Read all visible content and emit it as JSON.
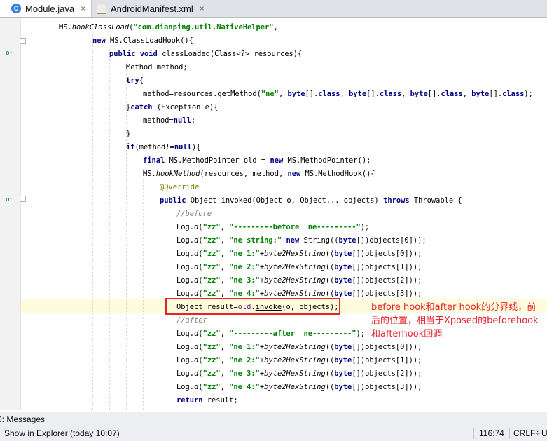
{
  "tabs": [
    {
      "label": "Module.java",
      "icon": "java-class-icon",
      "icon_letter": "C",
      "active": true
    },
    {
      "label": "AndroidManifest.xml",
      "icon": "xml-file-icon",
      "active": false
    }
  ],
  "close_glyph": "×",
  "code": [
    {
      "segs": [
        {
          "t": "MS."
        },
        {
          "t": "hookClassLoad",
          "c": "it"
        },
        {
          "t": "("
        },
        {
          "t": "\"com.dianping.util.NativeHelper\"",
          "c": "str"
        },
        {
          "t": ","
        }
      ]
    },
    {
      "segs": [
        {
          "t": "new ",
          "c": "kw"
        },
        {
          "t": "MS.ClassLoadHook(){"
        }
      ]
    },
    {
      "segs": [
        {
          "t": "public void ",
          "c": "kw"
        },
        {
          "t": "classLoaded(Class<?> resources){"
        }
      ]
    },
    {
      "segs": [
        {
          "t": "Method method;"
        }
      ]
    },
    {
      "segs": [
        {
          "t": "try",
          "c": "kw"
        },
        {
          "t": "{"
        }
      ]
    },
    {
      "segs": [
        {
          "t": "method=resources.getMethod("
        },
        {
          "t": "\"ne\"",
          "c": "str"
        },
        {
          "t": ", "
        },
        {
          "t": "byte",
          "c": "kw"
        },
        {
          "t": "[]."
        },
        {
          "t": "class",
          "c": "kw"
        },
        {
          "t": ", "
        },
        {
          "t": "byte",
          "c": "kw"
        },
        {
          "t": "[]."
        },
        {
          "t": "class",
          "c": "kw"
        },
        {
          "t": ", "
        },
        {
          "t": "byte",
          "c": "kw"
        },
        {
          "t": "[]."
        },
        {
          "t": "class",
          "c": "kw"
        },
        {
          "t": ", "
        },
        {
          "t": "byte",
          "c": "kw"
        },
        {
          "t": "[]."
        },
        {
          "t": "class",
          "c": "kw"
        },
        {
          "t": ");"
        }
      ]
    },
    {
      "segs": [
        {
          "t": "}"
        },
        {
          "t": "catch ",
          "c": "kw"
        },
        {
          "t": "(Exception e){"
        }
      ]
    },
    {
      "segs": [
        {
          "t": "method="
        },
        {
          "t": "null",
          "c": "kw"
        },
        {
          "t": ";"
        }
      ]
    },
    {
      "segs": [
        {
          "t": "}"
        }
      ]
    },
    {
      "segs": [
        {
          "t": "if",
          "c": "kw"
        },
        {
          "t": "(method!="
        },
        {
          "t": "null",
          "c": "kw"
        },
        {
          "t": "){"
        }
      ]
    },
    {
      "segs": [
        {
          "t": "final ",
          "c": "kw"
        },
        {
          "t": "MS.MethodPointer old = "
        },
        {
          "t": "new ",
          "c": "kw"
        },
        {
          "t": "MS.MethodPointer();"
        }
      ]
    },
    {
      "segs": [
        {
          "t": "MS."
        },
        {
          "t": "hookMethod",
          "c": "it"
        },
        {
          "t": "(resources, method, "
        },
        {
          "t": "new ",
          "c": "kw"
        },
        {
          "t": "MS.MethodHook(){"
        }
      ]
    },
    {
      "segs": [
        {
          "t": "@Override",
          "c": "ann"
        }
      ]
    },
    {
      "segs": [
        {
          "t": "public ",
          "c": "kw"
        },
        {
          "t": "Object invoked(Object o, Object... objects) "
        },
        {
          "t": "throws ",
          "c": "kw"
        },
        {
          "t": "Throwable {"
        }
      ]
    },
    {
      "segs": [
        {
          "t": "//before",
          "c": "cm"
        }
      ]
    },
    {
      "segs": [
        {
          "t": "Log."
        },
        {
          "t": "d",
          "c": "it"
        },
        {
          "t": "("
        },
        {
          "t": "\"zz\"",
          "c": "str"
        },
        {
          "t": ", "
        },
        {
          "t": "\"---------before  ne---------\"",
          "c": "str"
        },
        {
          "t": ");"
        }
      ]
    },
    {
      "segs": [
        {
          "t": "Log."
        },
        {
          "t": "d",
          "c": "it"
        },
        {
          "t": "("
        },
        {
          "t": "\"zz\"",
          "c": "str"
        },
        {
          "t": ", "
        },
        {
          "t": "\"ne string:\"",
          "c": "str"
        },
        {
          "t": "+"
        },
        {
          "t": "new ",
          "c": "kw"
        },
        {
          "t": "String(("
        },
        {
          "t": "byte",
          "c": "kw"
        },
        {
          "t": "[])objects[0]));"
        }
      ]
    },
    {
      "segs": [
        {
          "t": "Log."
        },
        {
          "t": "d",
          "c": "it"
        },
        {
          "t": "("
        },
        {
          "t": "\"zz\"",
          "c": "str"
        },
        {
          "t": ", "
        },
        {
          "t": "\"ne 1:\"",
          "c": "str"
        },
        {
          "t": "+"
        },
        {
          "t": "byte2HexString",
          "c": "it"
        },
        {
          "t": "(("
        },
        {
          "t": "byte",
          "c": "kw"
        },
        {
          "t": "[])objects[0]));"
        }
      ]
    },
    {
      "segs": [
        {
          "t": "Log."
        },
        {
          "t": "d",
          "c": "it"
        },
        {
          "t": "("
        },
        {
          "t": "\"zz\"",
          "c": "str"
        },
        {
          "t": ", "
        },
        {
          "t": "\"ne 2:\"",
          "c": "str"
        },
        {
          "t": "+"
        },
        {
          "t": "byte2HexString",
          "c": "it"
        },
        {
          "t": "(("
        },
        {
          "t": "byte",
          "c": "kw"
        },
        {
          "t": "[])objects[1]));"
        }
      ]
    },
    {
      "segs": [
        {
          "t": "Log."
        },
        {
          "t": "d",
          "c": "it"
        },
        {
          "t": "("
        },
        {
          "t": "\"zz\"",
          "c": "str"
        },
        {
          "t": ", "
        },
        {
          "t": "\"ne 3:\"",
          "c": "str"
        },
        {
          "t": "+"
        },
        {
          "t": "byte2HexString",
          "c": "it"
        },
        {
          "t": "(("
        },
        {
          "t": "byte",
          "c": "kw"
        },
        {
          "t": "[])objects[2]));"
        }
      ]
    },
    {
      "segs": [
        {
          "t": "Log."
        },
        {
          "t": "d",
          "c": "it"
        },
        {
          "t": "("
        },
        {
          "t": "\"zz\"",
          "c": "str"
        },
        {
          "t": ", "
        },
        {
          "t": "\"ne 4:\"",
          "c": "str"
        },
        {
          "t": "+"
        },
        {
          "t": "byte2HexString",
          "c": "it"
        },
        {
          "t": "(("
        },
        {
          "t": "byte",
          "c": "kw"
        },
        {
          "t": "[])objects[3]));"
        }
      ]
    },
    {
      "segs": [
        {
          "t": "Object result="
        },
        {
          "t": "old",
          "c": "field"
        },
        {
          "t": "."
        },
        {
          "t": "invoke",
          "c": "ul"
        },
        {
          "t": "(o, objects);"
        }
      ]
    },
    {
      "segs": [
        {
          "t": "//after",
          "c": "cm"
        }
      ]
    },
    {
      "segs": [
        {
          "t": "Log."
        },
        {
          "t": "d",
          "c": "it"
        },
        {
          "t": "("
        },
        {
          "t": "\"zz\"",
          "c": "str"
        },
        {
          "t": ", "
        },
        {
          "t": "\"---------after  ne---------\"",
          "c": "str"
        },
        {
          "t": ");"
        }
      ]
    },
    {
      "segs": [
        {
          "t": "Log."
        },
        {
          "t": "d",
          "c": "it"
        },
        {
          "t": "("
        },
        {
          "t": "\"zz\"",
          "c": "str"
        },
        {
          "t": ", "
        },
        {
          "t": "\"ne 1:\"",
          "c": "str"
        },
        {
          "t": "+"
        },
        {
          "t": "byte2HexString",
          "c": "it"
        },
        {
          "t": "(("
        },
        {
          "t": "byte",
          "c": "kw"
        },
        {
          "t": "[])objects[0]));"
        }
      ]
    },
    {
      "segs": [
        {
          "t": "Log."
        },
        {
          "t": "d",
          "c": "it"
        },
        {
          "t": "("
        },
        {
          "t": "\"zz\"",
          "c": "str"
        },
        {
          "t": ", "
        },
        {
          "t": "\"ne 2:\"",
          "c": "str"
        },
        {
          "t": "+"
        },
        {
          "t": "byte2HexString",
          "c": "it"
        },
        {
          "t": "(("
        },
        {
          "t": "byte",
          "c": "kw"
        },
        {
          "t": "[])objects[1]));"
        }
      ]
    },
    {
      "segs": [
        {
          "t": "Log."
        },
        {
          "t": "d",
          "c": "it"
        },
        {
          "t": "("
        },
        {
          "t": "\"zz\"",
          "c": "str"
        },
        {
          "t": ", "
        },
        {
          "t": "\"ne 3:\"",
          "c": "str"
        },
        {
          "t": "+"
        },
        {
          "t": "byte2HexString",
          "c": "it"
        },
        {
          "t": "(("
        },
        {
          "t": "byte",
          "c": "kw"
        },
        {
          "t": "[])objects[2]));"
        }
      ]
    },
    {
      "segs": [
        {
          "t": "Log."
        },
        {
          "t": "d",
          "c": "it"
        },
        {
          "t": "("
        },
        {
          "t": "\"zz\"",
          "c": "str"
        },
        {
          "t": ", "
        },
        {
          "t": "\"ne 4:\"",
          "c": "str"
        },
        {
          "t": "+"
        },
        {
          "t": "byte2HexString",
          "c": "it"
        },
        {
          "t": "(("
        },
        {
          "t": "byte",
          "c": "kw"
        },
        {
          "t": "[])objects[3]));"
        }
      ]
    },
    {
      "segs": [
        {
          "t": "return ",
          "c": "kw"
        },
        {
          "t": "result;"
        }
      ]
    }
  ],
  "gutter_icons": [
    {
      "name": "overriding-method-icon",
      "glyph": "o↑"
    },
    {
      "name": "overriding-method-icon",
      "glyph": "o↑"
    }
  ],
  "annotation_note": "before hook和after hook的分界线，前后的位置，相当于Xposed的beforehook和afterhook回调",
  "bottom_tool": "0: Messages",
  "status": {
    "message": "Show in Explorer (today 10:07)",
    "position": "116:74",
    "line_separator": "CRLF÷",
    "encoding": "U"
  },
  "colors": {
    "keyword": "#000080",
    "string": "#008000",
    "annotation": "#808000",
    "comment": "#808080",
    "highlight_box": "#e4242b",
    "caret_row": "#fffbdd"
  }
}
